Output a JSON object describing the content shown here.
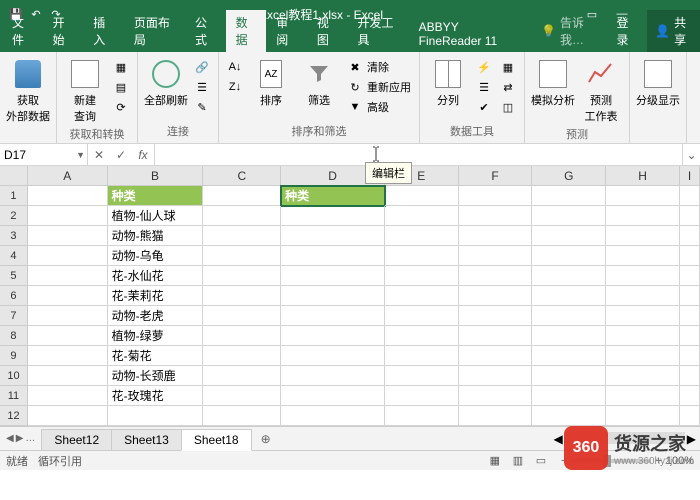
{
  "titlebar": {
    "title": "Excel教程1.xlsx - Excel"
  },
  "tabs": {
    "file": "文件",
    "home": "开始",
    "insert": "插入",
    "layout": "页面布局",
    "formula": "公式",
    "data": "数据",
    "review": "审阅",
    "view": "视图",
    "dev": "开发工具",
    "abbyy": "ABBYY FineReader 11",
    "tell": "告诉我…",
    "login": "登录",
    "share": "共享"
  },
  "ribbon": {
    "get_data": "获取\n外部数据",
    "new_query": "新建\n查询",
    "refresh_all": "全部刷新",
    "sort_az": "A|Z\nZ|A",
    "sort": "排序",
    "filter": "筛选",
    "clear": "清除",
    "reapply": "重新应用",
    "advanced": "高级",
    "text_to_col": "分列",
    "whatif": "模拟分析",
    "forecast": "预测\n工作表",
    "outline": "分级显示",
    "g_get": "获取和转换",
    "g_conn": "连接",
    "g_sortfilter": "排序和筛选",
    "g_tools": "数据工具",
    "g_forecast": "预测"
  },
  "namebox": "D17",
  "fx": "fx",
  "tooltip": "编辑栏",
  "columns": [
    "A",
    "B",
    "C",
    "D",
    "E",
    "F",
    "G",
    "H",
    "I"
  ],
  "rows": [
    {
      "n": "1",
      "B": "种类",
      "B_hdr": true,
      "D": "种类",
      "D_hdr": true,
      "D_sel": true
    },
    {
      "n": "2",
      "B": "植物-仙人球"
    },
    {
      "n": "3",
      "B": "动物-熊猫"
    },
    {
      "n": "4",
      "B": "动物-乌龟"
    },
    {
      "n": "5",
      "B": "花-水仙花"
    },
    {
      "n": "6",
      "B": "花-茉莉花"
    },
    {
      "n": "7",
      "B": "动物-老虎"
    },
    {
      "n": "8",
      "B": "植物-绿萝"
    },
    {
      "n": "9",
      "B": "花-菊花"
    },
    {
      "n": "10",
      "B": "动物-长颈鹿"
    },
    {
      "n": "11",
      "B": "花-玫瑰花"
    },
    {
      "n": "12",
      "B": ""
    }
  ],
  "sheets": {
    "s1": "Sheet12",
    "s2": "Sheet13",
    "s3": "Sheet18"
  },
  "status": {
    "ready": "就绪",
    "circ": "循环引用",
    "zoom": "100%"
  },
  "watermark": {
    "badge": "360",
    "name": "货源之家",
    "url": "www.360hyzj.com"
  }
}
